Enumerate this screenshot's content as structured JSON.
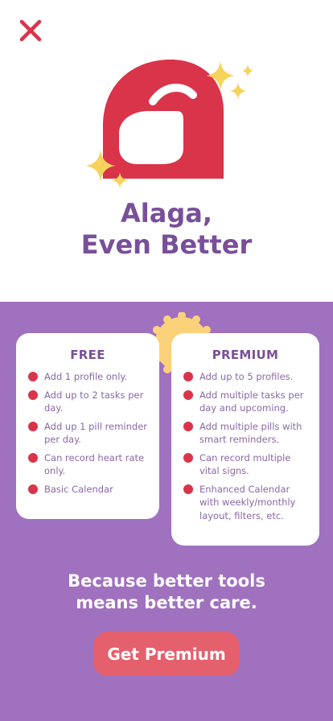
{
  "colors": {
    "accent_red": "#d9344a",
    "brand_purple": "#7a4f99",
    "panel_purple": "#a071bf",
    "button_coral": "#e5606d",
    "sparkle_yellow": "#f7d35c"
  },
  "icons": {
    "close": "close-icon",
    "logo": "alaga-logo",
    "sparkle": "sparkle-icon",
    "bullet": "bullet-dot-icon"
  },
  "header": {
    "title_line1": "Alaga,",
    "title_line2": "Even Better"
  },
  "plans": {
    "free": {
      "title": "FREE",
      "features": [
        "Add 1 profile only.",
        "Add up to 2 tasks per day.",
        "Add up 1 pill reminder per day.",
        "Can record heart rate only.",
        "Basic Calendar"
      ]
    },
    "premium": {
      "title": "PREMIUM",
      "features": [
        "Add up to 5 profiles.",
        "Add multiple tasks per day and upcoming.",
        "Add multiple pills with smart reminders.",
        "Can record multiple vital signs.",
        "Enhanced Calendar with weekly/monthly layout, filters, etc."
      ]
    }
  },
  "tagline": {
    "line1": "Because better tools",
    "line2": "means better care."
  },
  "cta": {
    "label": "Get Premium"
  }
}
